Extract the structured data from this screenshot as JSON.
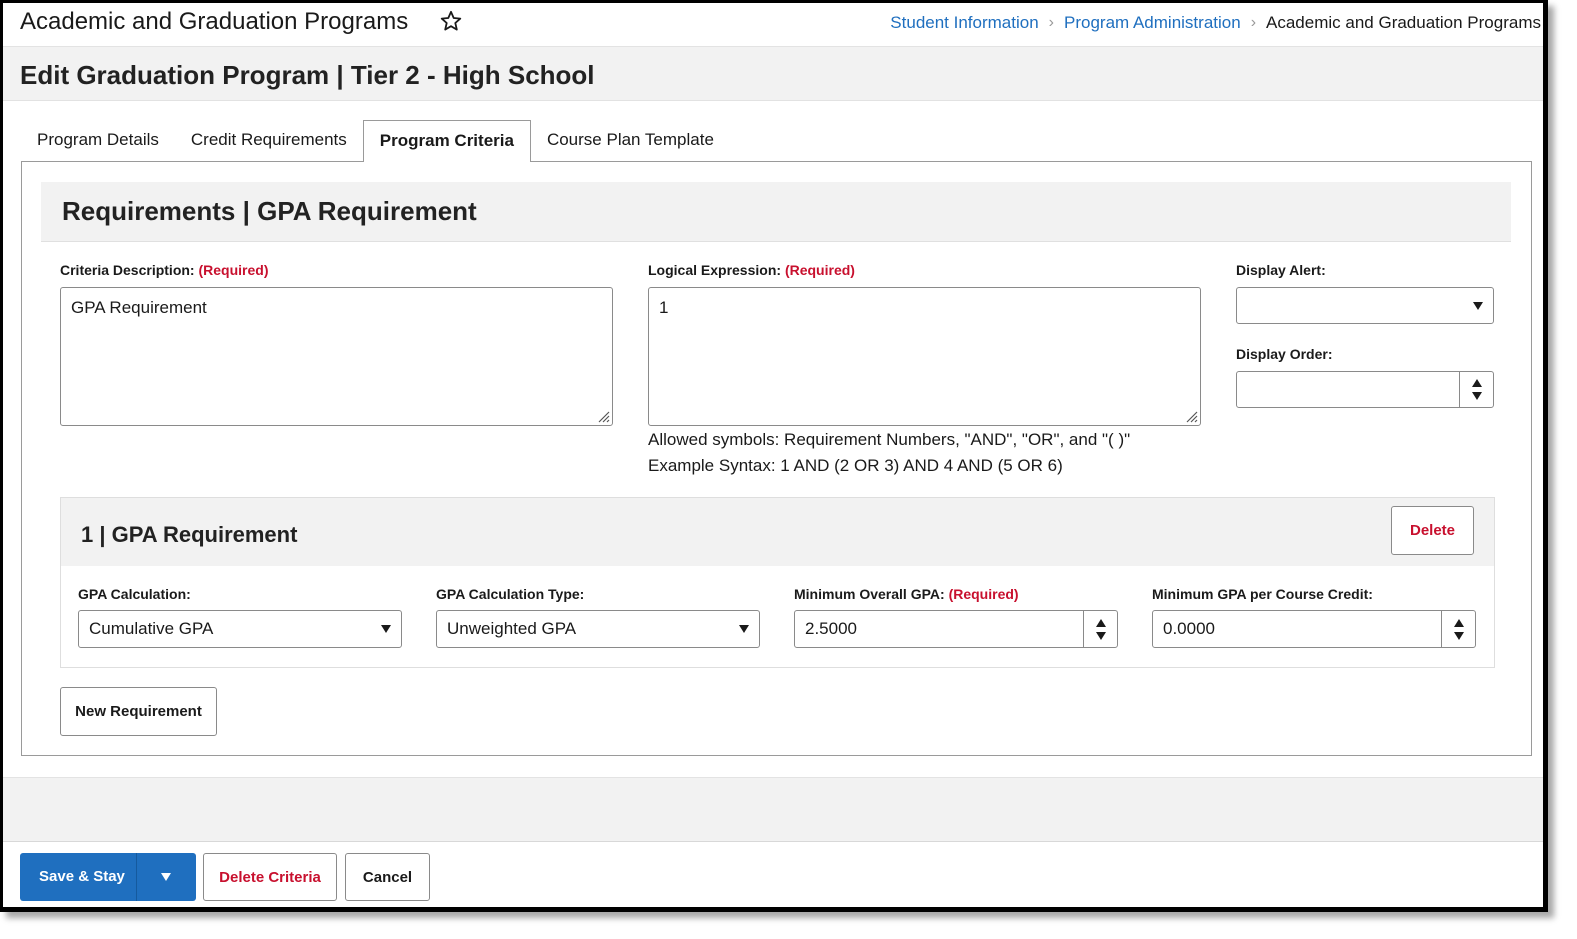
{
  "header": {
    "app_title": "Academic and Graduation Programs",
    "breadcrumbs": [
      "Student Information",
      "Program Administration"
    ],
    "breadcrumb_current": "Academic and Graduation Programs"
  },
  "page_title": "Edit Graduation Program | Tier 2 - High School",
  "tabs": [
    {
      "label": "Program Details"
    },
    {
      "label": "Credit Requirements"
    },
    {
      "label": "Program Criteria",
      "active": true
    },
    {
      "label": "Course Plan Template"
    }
  ],
  "requirements": {
    "title": "Requirements | GPA Requirement",
    "criteria_description": {
      "label": "Criteria Description:",
      "required": "(Required)",
      "value": "GPA Requirement"
    },
    "logical_expression": {
      "label": "Logical Expression:",
      "required": "(Required)",
      "value": "1",
      "help_1": "Allowed symbols: Requirement Numbers, \"AND\", \"OR\", and \"( )\"",
      "help_2": "Example Syntax: 1 AND (2 OR 3) AND 4 AND (5 OR 6)"
    },
    "display_alert": {
      "label": "Display Alert:",
      "value": ""
    },
    "display_order": {
      "label": "Display Order:",
      "value": ""
    }
  },
  "requirement_item": {
    "title": "1 | GPA Requirement",
    "delete_label": "Delete",
    "gpa_calculation": {
      "label": "GPA Calculation:",
      "value": "Cumulative GPA"
    },
    "gpa_calculation_type": {
      "label": "GPA Calculation Type:",
      "value": "Unweighted GPA"
    },
    "minimum_overall_gpa": {
      "label": "Minimum Overall GPA:",
      "required": "(Required)",
      "value": "2.5000"
    },
    "minimum_gpa_per_credit": {
      "label": "Minimum GPA per Course Credit:",
      "value": "0.0000"
    }
  },
  "new_requirement_label": "New Requirement",
  "footer": {
    "save_label": "Save & Stay",
    "delete_criteria_label": "Delete Criteria",
    "cancel_label": "Cancel"
  },
  "colors": {
    "link_blue": "#1f6fbf",
    "required_red": "#c8102e",
    "header_gray": "#f2f2f2"
  }
}
